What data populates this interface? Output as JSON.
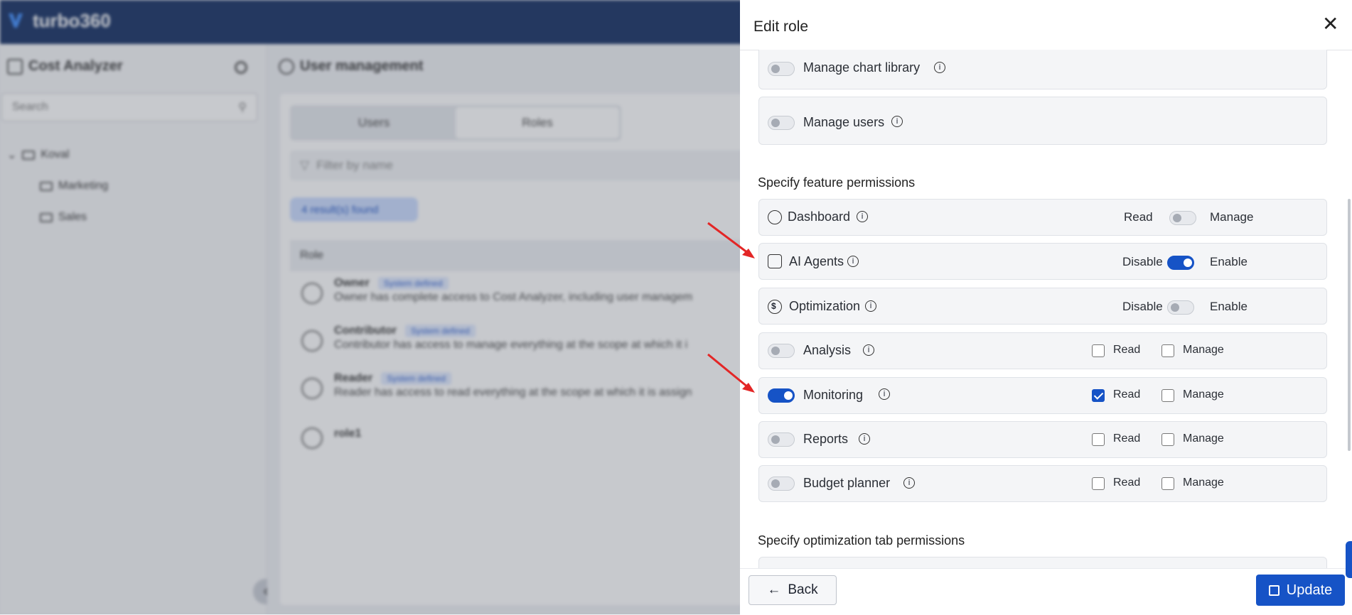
{
  "app": {
    "brand": "turbo360"
  },
  "left_panel": {
    "title": "Cost Analyzer",
    "search_placeholder": "Search",
    "tree": [
      {
        "label": "Koval"
      },
      {
        "label": "Marketing"
      },
      {
        "label": "Sales"
      }
    ]
  },
  "main": {
    "title": "User management",
    "tabs": [
      {
        "label": "Users"
      },
      {
        "label": "Roles"
      }
    ],
    "filter_placeholder": "Filter by name",
    "results": "4 result(s) found",
    "table_header": "Role",
    "roles": [
      {
        "name": "Owner",
        "badge": "System defined",
        "desc": "Owner has complete access to Cost Analyzer, including user managem"
      },
      {
        "name": "Contributor",
        "badge": "System defined",
        "desc": "Contributor has access to manage everything at the scope at which it i"
      },
      {
        "name": "Reader",
        "badge": "System defined",
        "desc": "Reader has access to read everything at the scope at which it is assign"
      },
      {
        "name": "role1",
        "badge": "",
        "desc": ""
      }
    ]
  },
  "drawer": {
    "title": "Edit role",
    "top_permissions": [
      {
        "label": "Manage chart library",
        "enabled": false
      },
      {
        "label": "Manage users",
        "enabled": false
      }
    ],
    "feature_section_title": "Specify feature permissions",
    "features": [
      {
        "label": "Dashboard",
        "icon": "dashboard-icon",
        "left": "Read",
        "right": "Manage",
        "type": "toggle-mid",
        "enabled": false
      },
      {
        "label": "AI Agents",
        "icon": "ai-agents-icon",
        "left": "Disable",
        "right": "Enable",
        "type": "toggle-mid",
        "enabled": true
      },
      {
        "label": "Optimization",
        "icon": "dollar-icon",
        "left": "Disable",
        "right": "Enable",
        "type": "toggle-mid",
        "enabled": false
      },
      {
        "label": "Analysis",
        "type": "checks",
        "enabled": false,
        "read": false,
        "manage": false,
        "read_label": "Read",
        "manage_label": "Manage"
      },
      {
        "label": "Monitoring",
        "type": "checks",
        "enabled": true,
        "read": true,
        "manage": false,
        "read_label": "Read",
        "manage_label": "Manage"
      },
      {
        "label": "Reports",
        "type": "checks",
        "enabled": false,
        "read": false,
        "manage": false,
        "read_label": "Read",
        "manage_label": "Manage"
      },
      {
        "label": "Budget planner",
        "type": "checks",
        "enabled": false,
        "read": false,
        "manage": false,
        "read_label": "Read",
        "manage_label": "Manage"
      }
    ],
    "optimization_section_title": "Specify optimization tab permissions",
    "back_label": "Back",
    "update_label": "Update"
  },
  "colors": {
    "primary": "#1653c6",
    "topbar": "#0f2a5f",
    "arrow": "#e32626"
  }
}
